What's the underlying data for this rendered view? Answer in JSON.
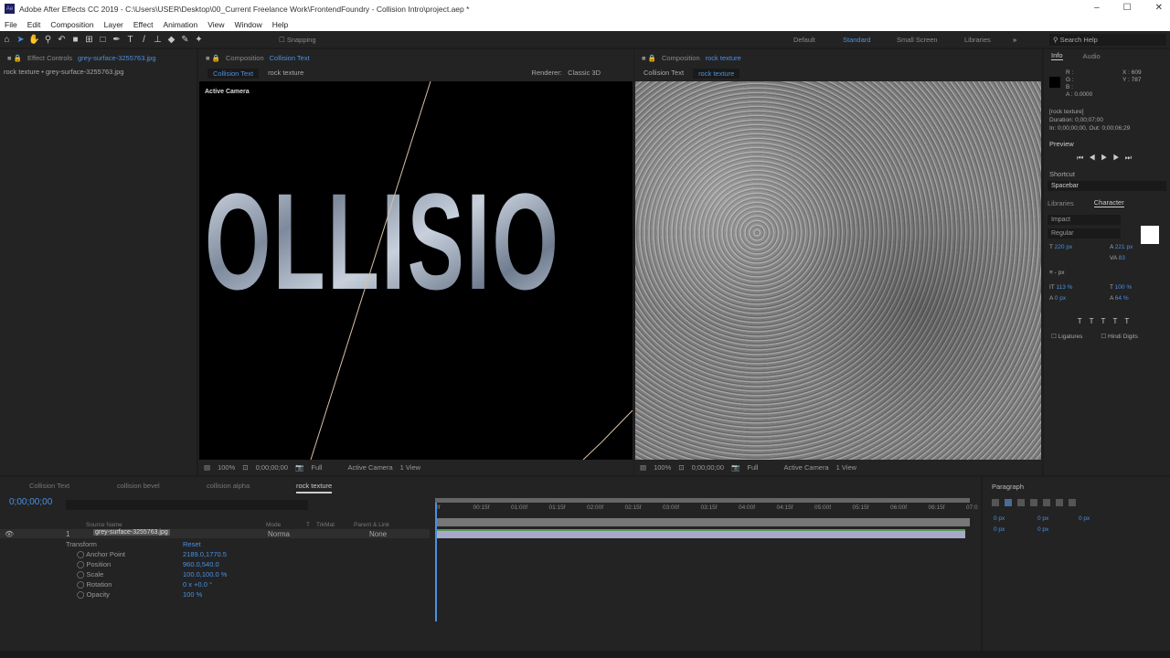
{
  "titlebar": {
    "title": "Adobe After Effects CC 2019 - C:\\Users\\USER\\Desktop\\00_Current Freelance Work\\FrontendFoundry - Collision Intro\\project.aep *",
    "app_icon": "Ae"
  },
  "menu": [
    "File",
    "Edit",
    "Composition",
    "Layer",
    "Effect",
    "Animation",
    "View",
    "Window",
    "Help"
  ],
  "toolbar": {
    "snapping": "Snapping",
    "workspaces": [
      "Default",
      "Standard",
      "Small Screen",
      "Libraries"
    ],
    "active_workspace": "Standard",
    "search_placeholder": "Search Help"
  },
  "effect_controls": {
    "label": "Effect Controls",
    "layer": "grey-surface-3255763.jpg",
    "subtitle": "rock texture • grey-surface-3255763.jpg"
  },
  "comp1": {
    "label": "Composition",
    "name": "Collision Text",
    "crumbs": [
      "Collision Text",
      "rock texture"
    ],
    "renderer_label": "Renderer:",
    "renderer": "Classic 3D",
    "camera_label": "Active Camera",
    "text": "OLLISIO",
    "toolbar": {
      "zoom": "100%",
      "time": "0;00;00;00",
      "resolution": "Full",
      "camera": "Active Camera",
      "view": "1 View"
    }
  },
  "comp2": {
    "label": "Composition",
    "name": "rock texture",
    "crumbs": [
      "Collision Text",
      "rock texture"
    ],
    "toolbar": {
      "zoom": "100%",
      "time": "0;00;00;00",
      "resolution": "Full",
      "camera": "Active Camera",
      "view": "1 View"
    }
  },
  "info": {
    "tabs": [
      "Info",
      "Audio"
    ],
    "r": "R :",
    "g": "G :",
    "b": "B :",
    "a": "A : 0.0000",
    "x": "X : 609",
    "y": "Y : 787",
    "layer": "[rock texture]",
    "duration": "Duration: 0;00;07;00",
    "inout": "In: 0;00;00;00, Out: 0;00;06;29"
  },
  "preview": {
    "title": "Preview",
    "shortcut_label": "Shortcut",
    "shortcut": "Spacebar"
  },
  "character": {
    "tabs": [
      "Libraries",
      "Character"
    ],
    "font": "Impact",
    "style": "Regular",
    "size": "220 px",
    "leading": "221 px",
    "tracking": "83",
    "vscale": "113 %",
    "hscale": "100 %",
    "baseline": "0 px",
    "tsume": "64 %",
    "stroke": "- px",
    "ligatures": "Ligatures",
    "hindi": "Hindi Digits"
  },
  "timeline": {
    "tabs": [
      "Collision Text",
      "collision bevel",
      "collision alpha",
      "rock texture"
    ],
    "active_tab": "rock texture",
    "timecode": "0;00;00;00",
    "columns": [
      "Source Name",
      "Mode",
      "T",
      "TrkMat",
      "Parent & Link"
    ],
    "layer": {
      "num": "1",
      "name": "grey-surface-3255763.jpg",
      "mode": "Norma",
      "parent": "None"
    },
    "transform": "Transform",
    "reset": "Reset",
    "props": [
      {
        "name": "Anchor Point",
        "value": "2189.0,1770.5"
      },
      {
        "name": "Position",
        "value": "960.0,540.0"
      },
      {
        "name": "Scale",
        "value": "100.0,100.0 %"
      },
      {
        "name": "Rotation",
        "value": "0 x +0.0 °"
      },
      {
        "name": "Opacity",
        "value": "100 %"
      }
    ],
    "ruler": [
      "0f",
      "00:15f",
      "01:00f",
      "01:15f",
      "02:00f",
      "02:15f",
      "03:00f",
      "03:15f",
      "04:00f",
      "04:15f",
      "05:00f",
      "05:15f",
      "06:00f",
      "06:15f",
      "07:0"
    ]
  },
  "paragraph": {
    "title": "Paragraph",
    "indent_left": "0 px",
    "indent_right": "0 px",
    "indent_first": "0 px",
    "space_before": "0 px",
    "space_after": "0 px"
  },
  "colors": {
    "accent": "#4a90e2",
    "panel": "#232323"
  }
}
